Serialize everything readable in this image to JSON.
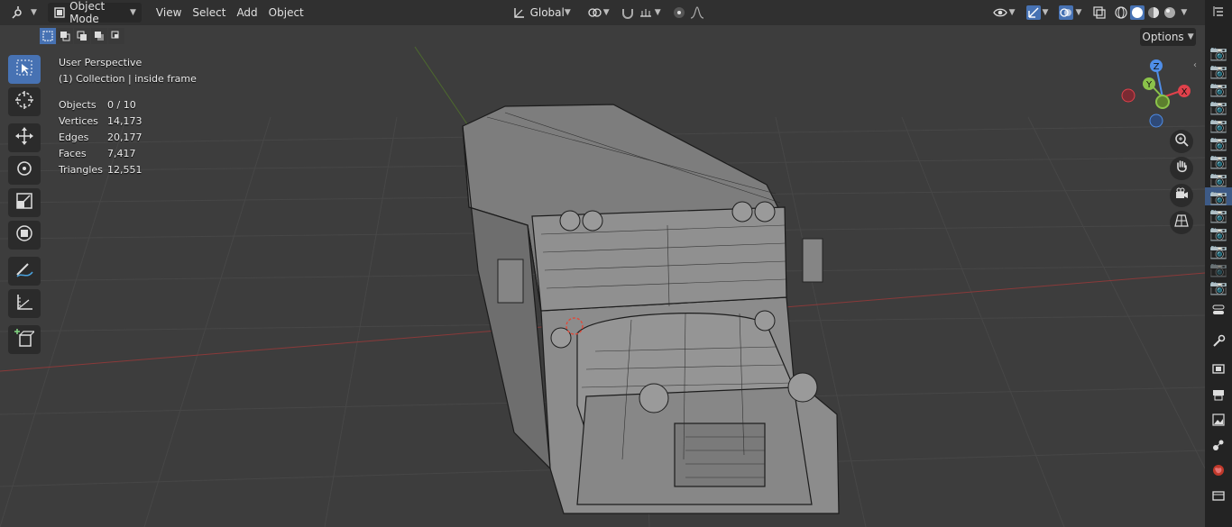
{
  "header": {
    "mode": "Object Mode",
    "menus": [
      "View",
      "Select",
      "Add",
      "Object"
    ],
    "transform_orientation": "Global",
    "options_label": "Options"
  },
  "overlay": {
    "view_name": "User Perspective",
    "collection_info": "(1) Collection | inside frame",
    "stats": [
      {
        "label": "Objects",
        "value": "0 / 10"
      },
      {
        "label": "Vertices",
        "value": "14,173"
      },
      {
        "label": "Edges",
        "value": "20,177"
      },
      {
        "label": "Faces",
        "value": "7,417"
      },
      {
        "label": "Triangles",
        "value": "12,551"
      }
    ]
  },
  "gizmo": {
    "z": "Z",
    "y": "Y",
    "x": "X"
  },
  "colors": {
    "accent": "#4772b3",
    "axis_x": "#e0414b",
    "axis_y": "#8bc34a",
    "axis_z": "#4f8ee8",
    "header_bg": "#303030",
    "viewport_bg": "#3d3d3d"
  },
  "toolbar_icons": [
    "select-box-icon",
    "cursor-icon",
    "move-icon",
    "rotate-icon",
    "scale-icon",
    "transform-icon",
    "annotate-icon",
    "measure-icon",
    "add-cube-icon"
  ],
  "nav_icons": [
    "zoom-icon",
    "pan-hand-icon",
    "camera-icon",
    "ortho-grid-icon"
  ]
}
